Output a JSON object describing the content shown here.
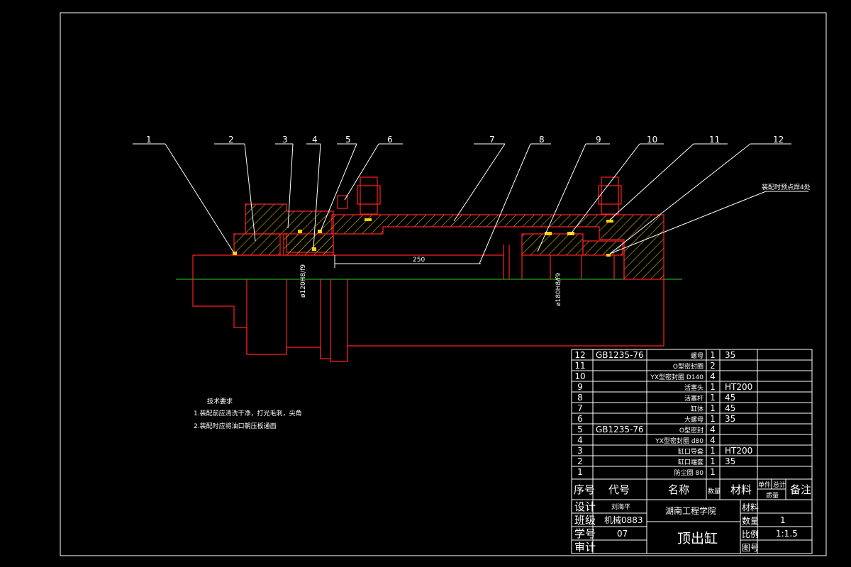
{
  "drawing": {
    "balloons": [
      "1",
      "2",
      "3",
      "4",
      "5",
      "6",
      "7",
      "8",
      "9",
      "10",
      "11",
      "12"
    ],
    "balloon_note": "装配时预点焊4处",
    "dimension_stroke": "250",
    "dimension_dia_left": "ø120H8/f9",
    "dimension_dia_right": "ø180H8/f9"
  },
  "tech_requirements": {
    "title": "技术要求",
    "items": [
      "1.装配前应清洗干净，打光毛刺，尖角",
      "2.装配时应将油口朝压板通面"
    ]
  },
  "bom": {
    "rows": [
      {
        "no": "12",
        "code": "GB1235-76",
        "name": "螺母",
        "qty": "1",
        "material": "35"
      },
      {
        "no": "11",
        "code": "",
        "name": "O型密封圈",
        "qty": "2",
        "material": ""
      },
      {
        "no": "10",
        "code": "",
        "name": "YX型密封圈 D140",
        "qty": "4",
        "material": ""
      },
      {
        "no": "9",
        "code": "",
        "name": "活塞头",
        "qty": "1",
        "material": "HT200"
      },
      {
        "no": "8",
        "code": "",
        "name": "活塞杆",
        "qty": "1",
        "material": "45"
      },
      {
        "no": "7",
        "code": "",
        "name": "缸体",
        "qty": "1",
        "material": "45"
      },
      {
        "no": "6",
        "code": "",
        "name": "大螺母",
        "qty": "1",
        "material": "35"
      },
      {
        "no": "5",
        "code": "GB1235-76",
        "name": "O型密封",
        "qty": "4",
        "material": ""
      },
      {
        "no": "4",
        "code": "",
        "name": "YX型密封圈 d80",
        "qty": "4",
        "material": ""
      },
      {
        "no": "3",
        "code": "",
        "name": "缸口导套",
        "qty": "1",
        "material": "HT200"
      },
      {
        "no": "2",
        "code": "",
        "name": "缸口端套",
        "qty": "1",
        "material": "35"
      },
      {
        "no": "1",
        "code": "",
        "name": "防尘圈 80",
        "qty": "1",
        "material": ""
      }
    ],
    "headers": {
      "no": "序号",
      "code": "代号",
      "name": "名称",
      "qty": "数量",
      "material": "材料",
      "unit_weight": "单件",
      "total_weight": "总计",
      "weight": "质量",
      "remark": "备注"
    }
  },
  "title_block": {
    "design_label": "设计",
    "designer": "刘海平",
    "class_label": "班级",
    "class_value": "机械0883",
    "student_no_label": "学号",
    "student_no": "07",
    "review_label": "审计",
    "school": "湖南工程学院",
    "drawing_title": "顶出缸",
    "material_label": "材料",
    "quantity_label": "数量",
    "quantity": "1",
    "scale_label": "比例",
    "scale": "1:1.5",
    "drawing_no_label": "图号"
  },
  "colors": {
    "background": "#000000",
    "part_outline": "#ff2020",
    "centerline": "#2ecc2e",
    "seal": "#ffd200",
    "annotation": "#ffffff"
  }
}
